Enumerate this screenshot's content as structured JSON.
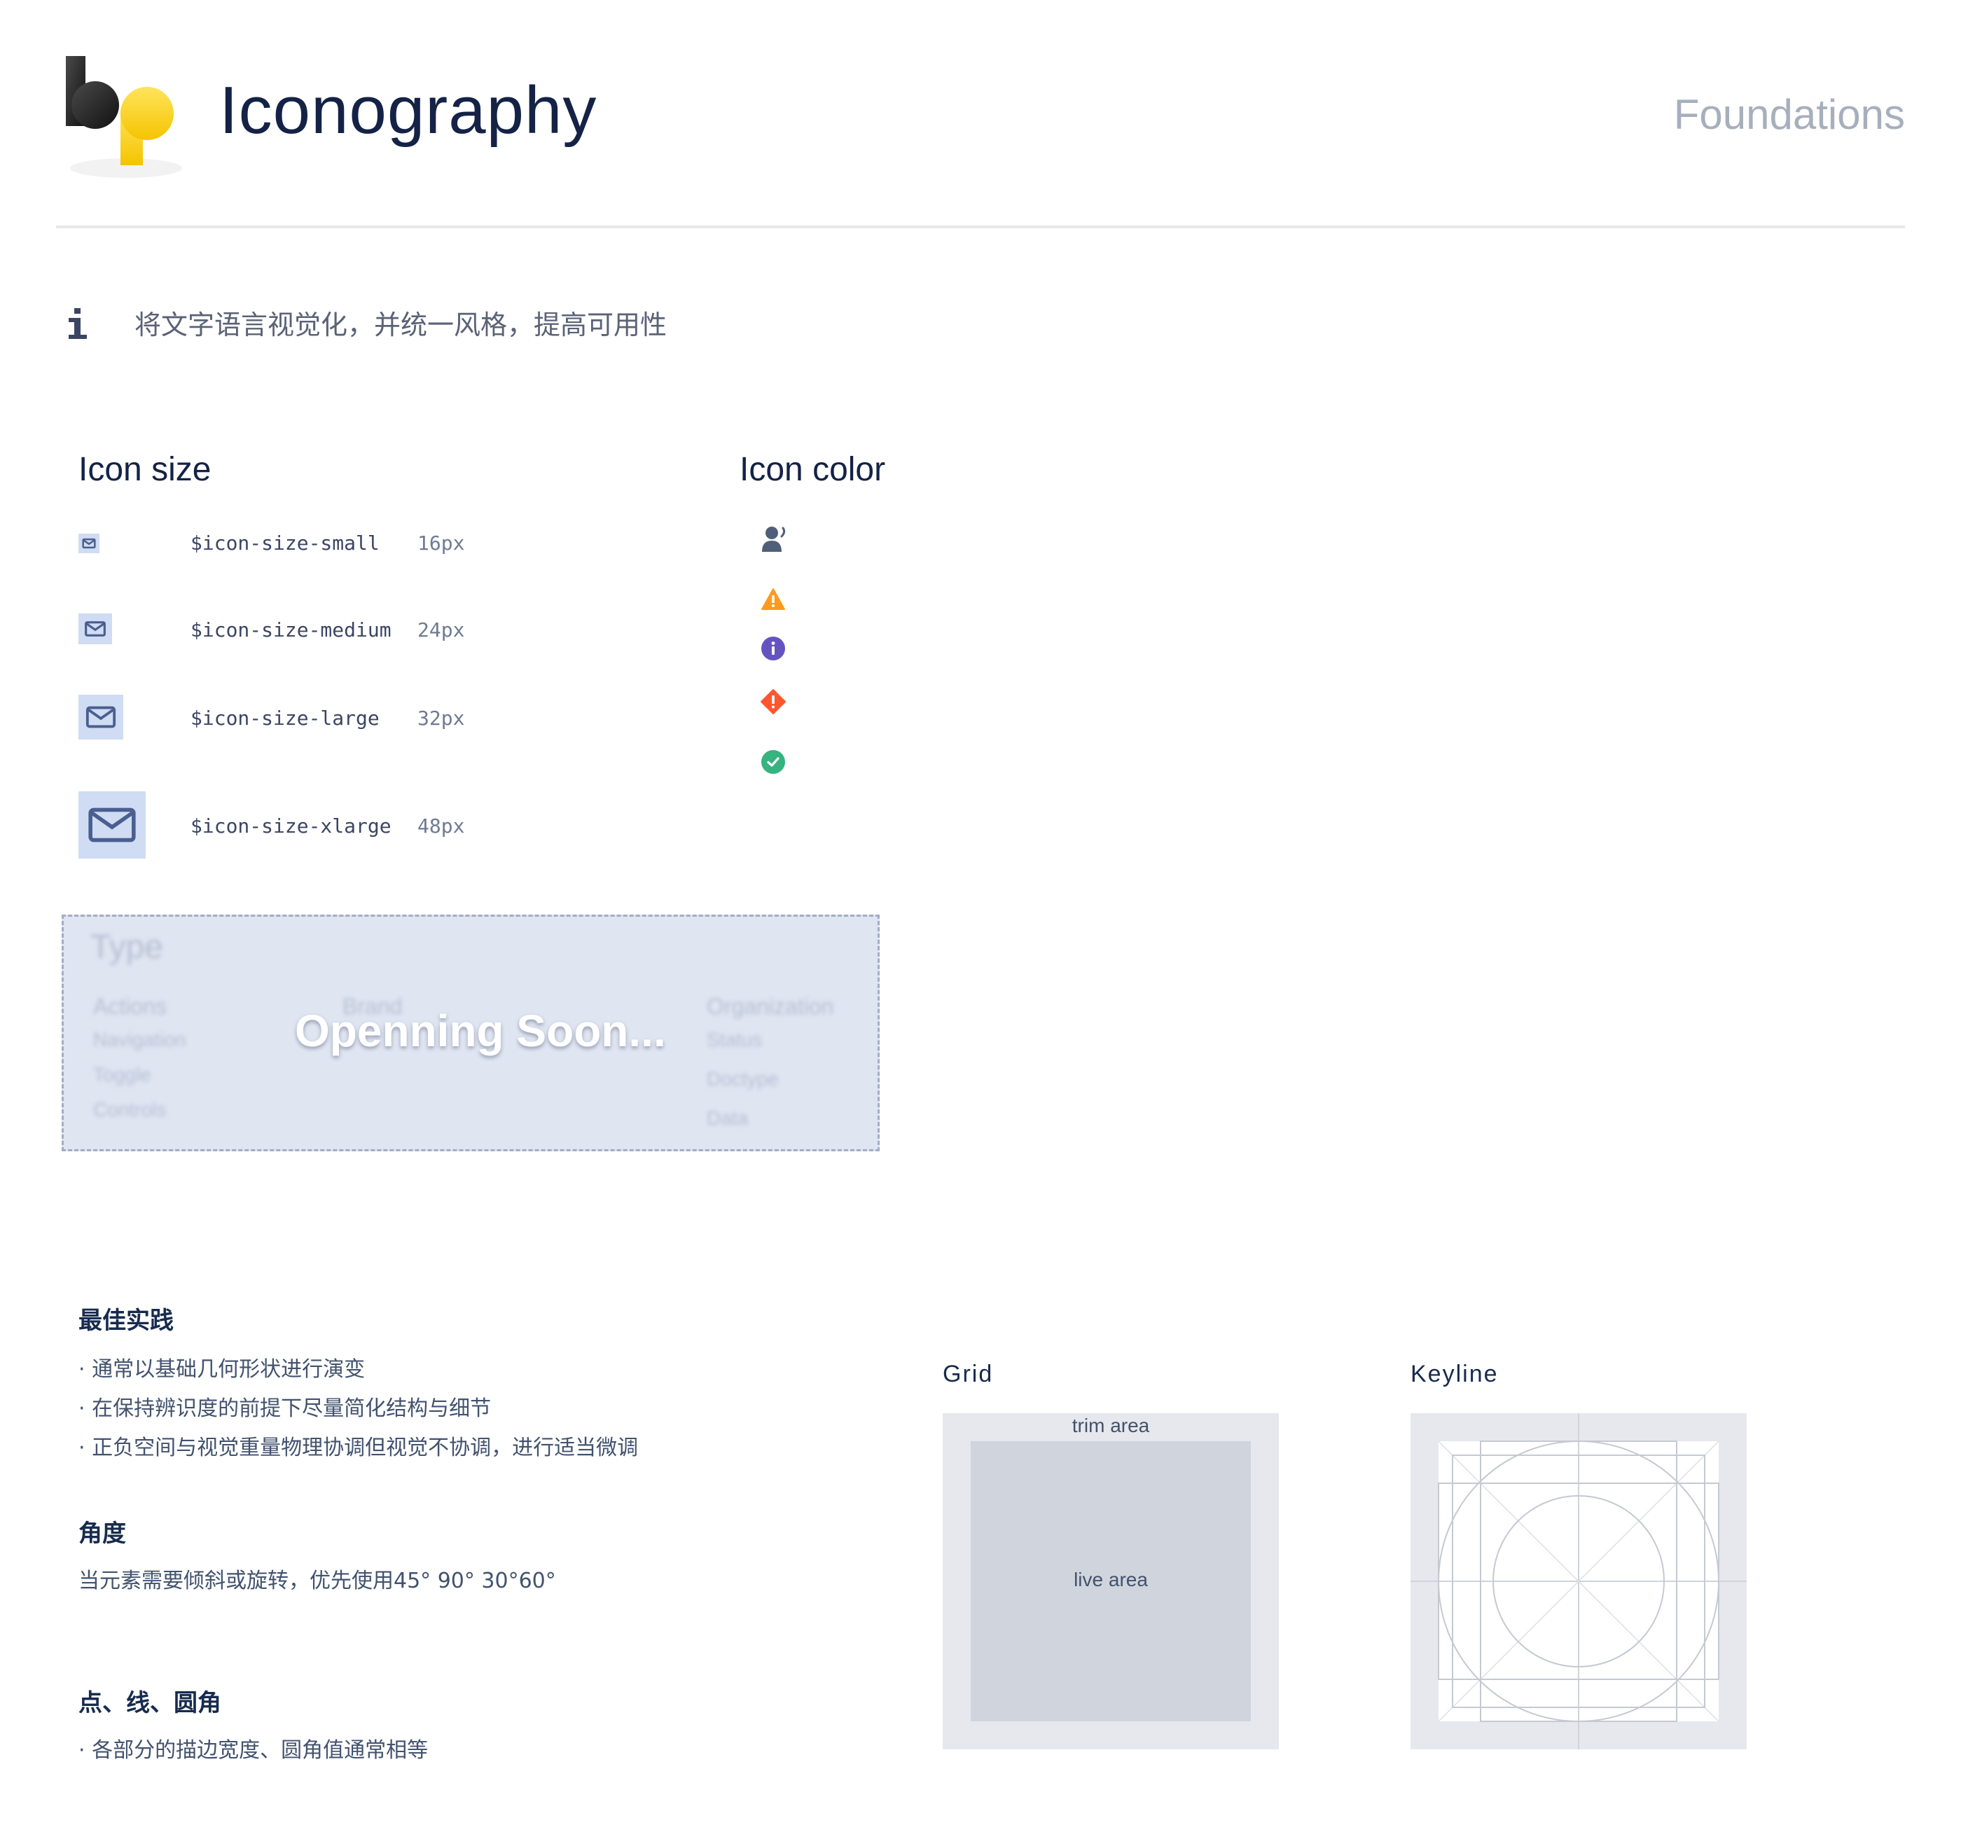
{
  "header": {
    "title": "Iconography",
    "section": "Foundations"
  },
  "intro": {
    "text": "将文字语言视觉化，并统一风格，提高可用性"
  },
  "icon_size": {
    "heading": "Icon size",
    "rows": [
      {
        "token": "$icon-size-small",
        "size": "16px"
      },
      {
        "token": "$icon-size-medium",
        "size": "24px"
      },
      {
        "token": "$icon-size-large",
        "size": "32px"
      },
      {
        "token": "$icon-size-xlarge",
        "size": "48px"
      }
    ],
    "icon": "envelope-icon"
  },
  "icon_color": {
    "heading": "Icon color",
    "icons": [
      {
        "name": "person-icon",
        "color": "#505f79"
      },
      {
        "name": "warning-icon",
        "color": "#ff991f"
      },
      {
        "name": "info-icon",
        "color": "#6554c0"
      },
      {
        "name": "error-icon",
        "color": "#ff5630"
      },
      {
        "name": "success-icon",
        "color": "#36b37e"
      }
    ]
  },
  "coming_soon": {
    "overlay": "Openning Soon...",
    "title": "Type",
    "col1": [
      "Actions",
      "Navigation",
      "Toggle",
      "Controls"
    ],
    "col2": [
      "Brand"
    ],
    "col3": [
      "Organization",
      "Status",
      "Doctype",
      "Data"
    ]
  },
  "best_practice": {
    "heading": "最佳实践",
    "items": [
      "· 通常以基础几何形状进行演变",
      "· 在保持辨识度的前提下尽量简化结构与细节",
      "· 正负空间与视觉重量物理协调但视觉不协调，进行适当微调"
    ]
  },
  "angle": {
    "heading": "角度",
    "text": "当元素需要倾斜或旋转，优先使用45° 90° 30°60°"
  },
  "point_line": {
    "heading": "点、线、圆角",
    "items": [
      "· 各部分的描边宽度、圆角值通常相等"
    ]
  },
  "grid": {
    "heading": "Grid",
    "trim_label": "trim area",
    "live_label": "live area"
  },
  "keyline": {
    "heading": "Keyline"
  },
  "colors": {
    "title": "#142246",
    "muted": "#a7afbd",
    "icon_bg": "#cfdcf3",
    "icon_fg": "#4a5f8f"
  }
}
